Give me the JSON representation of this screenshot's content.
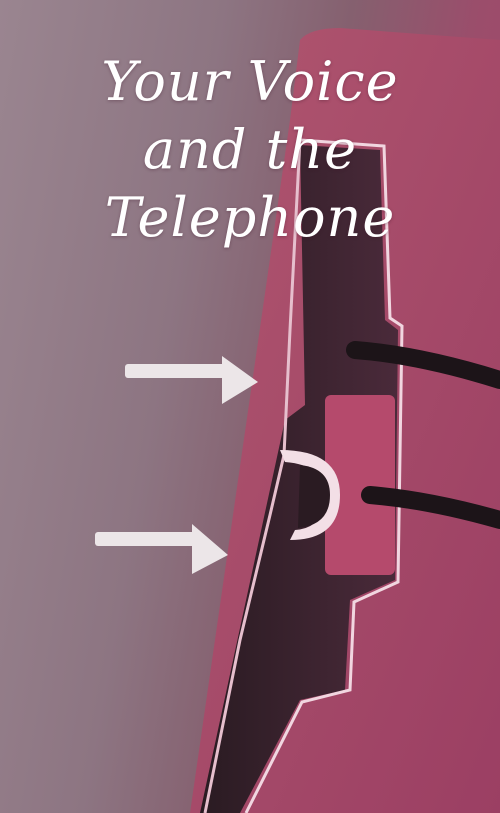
{
  "title": {
    "line1": "Your Voice",
    "line2": "and the",
    "line3": "Telephone"
  },
  "colors": {
    "background": "#8d7582",
    "panel": "#a5486a",
    "outline": "#f1d6e0",
    "cable": "#1c1418",
    "arrow": "#ece6e8",
    "title_text": "#ffffff"
  }
}
